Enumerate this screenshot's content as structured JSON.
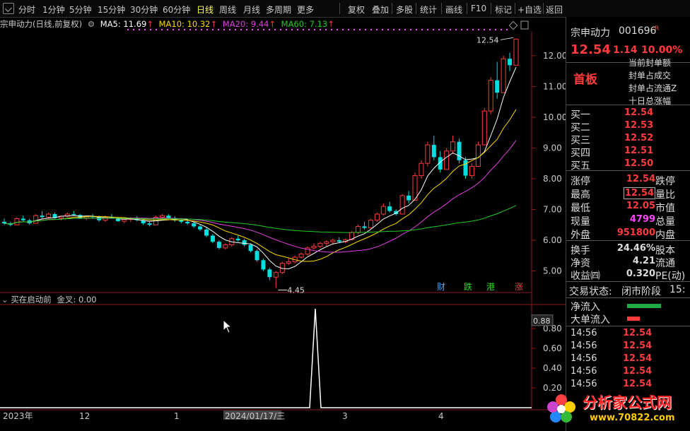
{
  "toolbar": {
    "left_items": [
      {
        "label": "分时",
        "active": false
      },
      {
        "label": "1分钟",
        "active": false
      },
      {
        "label": "5分钟",
        "active": false
      },
      {
        "label": "15分钟",
        "active": false
      },
      {
        "label": "30分钟",
        "active": false
      },
      {
        "label": "60分钟",
        "active": false
      },
      {
        "label": "日线",
        "active": true
      },
      {
        "label": "周线",
        "active": false
      },
      {
        "label": "月线",
        "active": false
      },
      {
        "label": "多周期",
        "active": false
      },
      {
        "label": "更多",
        "active": false
      }
    ],
    "right_items": [
      "复权",
      "叠加",
      "多股",
      "统计",
      "画线",
      "F10",
      "标记",
      "+自选",
      "返回"
    ]
  },
  "chart_header": {
    "stock_label": "宗申动力(日线,前复权)",
    "ma5": "MA5: 11.69",
    "ma10": "MA10: 10.32",
    "ma20": "MA20: 9.44",
    "ma60": "MA60: 7.13",
    "arrow": "↑"
  },
  "colors": {
    "up": "#ff3b3b",
    "down": "#00e0e0",
    "ma5": "#ffffff",
    "ma10": "#ffd700",
    "ma20": "#e040e0",
    "ma60": "#22cc22",
    "grid": "#8b1a1a"
  },
  "price_chart": {
    "y_ticks": [
      "12.00",
      "11.00",
      "10.00",
      "9.00",
      "8.00",
      "7.00",
      "6.00",
      "5.00"
    ],
    "high_label": "12.54",
    "low_label": "4.45",
    "markers": [
      {
        "text": "财",
        "color": "#44aaff"
      },
      {
        "text": "跌",
        "color": "#22dd22"
      },
      {
        "text": "港",
        "color": "#22dd22"
      },
      {
        "text": "涨",
        "color": "#ff3b3b"
      }
    ]
  },
  "chart_data": {
    "type": "candlestick",
    "ylim": [
      4.3,
      12.8
    ],
    "candles": [
      [
        6.6,
        6.7,
        6.5,
        6.55
      ],
      [
        6.55,
        6.6,
        6.45,
        6.5
      ],
      [
        6.5,
        6.75,
        6.5,
        6.7
      ],
      [
        6.7,
        6.8,
        6.6,
        6.65
      ],
      [
        6.65,
        6.7,
        6.5,
        6.55
      ],
      [
        6.55,
        6.85,
        6.55,
        6.8
      ],
      [
        6.8,
        6.95,
        6.7,
        6.75
      ],
      [
        6.75,
        6.9,
        6.7,
        6.85
      ],
      [
        6.85,
        6.9,
        6.7,
        6.72
      ],
      [
        6.72,
        6.8,
        6.65,
        6.78
      ],
      [
        6.78,
        6.9,
        6.75,
        6.85
      ],
      [
        6.85,
        6.95,
        6.8,
        6.82
      ],
      [
        6.82,
        6.85,
        6.7,
        6.72
      ],
      [
        6.72,
        6.8,
        6.65,
        6.78
      ],
      [
        6.78,
        6.85,
        6.7,
        6.75
      ],
      [
        6.75,
        6.8,
        6.6,
        6.65
      ],
      [
        6.65,
        6.8,
        6.6,
        6.75
      ],
      [
        6.75,
        6.85,
        6.7,
        6.72
      ],
      [
        6.72,
        6.75,
        6.6,
        6.62
      ],
      [
        6.62,
        6.7,
        6.55,
        6.68
      ],
      [
        6.68,
        6.75,
        6.6,
        6.7
      ],
      [
        6.7,
        6.78,
        6.62,
        6.65
      ],
      [
        6.65,
        6.7,
        6.5,
        6.55
      ],
      [
        6.55,
        6.6,
        6.45,
        6.5
      ],
      [
        6.5,
        6.8,
        6.5,
        6.75
      ],
      [
        6.75,
        6.85,
        6.7,
        6.8
      ],
      [
        6.8,
        6.85,
        6.7,
        6.72
      ],
      [
        6.72,
        6.78,
        6.6,
        6.65
      ],
      [
        6.65,
        6.7,
        6.55,
        6.6
      ],
      [
        6.6,
        6.65,
        6.5,
        6.55
      ],
      [
        6.55,
        6.6,
        6.4,
        6.45
      ],
      [
        6.45,
        6.5,
        6.3,
        6.35
      ],
      [
        6.35,
        6.4,
        6.1,
        6.15
      ],
      [
        6.15,
        6.2,
        5.9,
        5.95
      ],
      [
        5.95,
        6.0,
        5.7,
        5.75
      ],
      [
        5.75,
        5.9,
        5.7,
        5.85
      ],
      [
        5.85,
        6.1,
        5.8,
        6.05
      ],
      [
        6.05,
        6.15,
        5.95,
        6.0
      ],
      [
        6.0,
        6.05,
        5.8,
        5.85
      ],
      [
        5.85,
        5.9,
        5.6,
        5.65
      ],
      [
        5.65,
        5.7,
        5.3,
        5.35
      ],
      [
        5.35,
        5.4,
        5.0,
        5.05
      ],
      [
        5.05,
        5.1,
        4.7,
        4.8
      ],
      [
        4.8,
        5.0,
        4.45,
        4.95
      ],
      [
        4.95,
        5.3,
        4.9,
        5.25
      ],
      [
        5.25,
        5.4,
        5.2,
        5.3
      ],
      [
        5.3,
        5.5,
        5.25,
        5.45
      ],
      [
        5.45,
        5.6,
        5.4,
        5.55
      ],
      [
        5.55,
        5.8,
        5.5,
        5.75
      ],
      [
        5.75,
        5.9,
        5.7,
        5.8
      ],
      [
        5.8,
        5.95,
        5.75,
        5.9
      ],
      [
        5.9,
        6.0,
        5.8,
        5.95
      ],
      [
        5.95,
        6.05,
        5.85,
        6.0
      ],
      [
        6.0,
        6.1,
        5.9,
        5.95
      ],
      [
        5.95,
        6.05,
        5.9,
        6.02
      ],
      [
        6.02,
        6.3,
        6.0,
        6.25
      ],
      [
        6.25,
        6.5,
        6.2,
        6.45
      ],
      [
        6.45,
        6.6,
        6.35,
        6.4
      ],
      [
        6.4,
        6.7,
        6.4,
        6.65
      ],
      [
        6.65,
        6.9,
        6.6,
        6.85
      ],
      [
        6.85,
        7.2,
        6.8,
        7.1
      ],
      [
        7.1,
        7.25,
        6.9,
        6.95
      ],
      [
        6.95,
        7.0,
        6.8,
        6.85
      ],
      [
        6.85,
        7.5,
        6.85,
        7.45
      ],
      [
        7.45,
        7.6,
        7.2,
        7.3
      ],
      [
        7.3,
        8.2,
        7.3,
        8.1
      ],
      [
        8.1,
        8.6,
        8.0,
        8.5
      ],
      [
        8.5,
        9.2,
        8.4,
        9.1
      ],
      [
        9.1,
        9.4,
        8.6,
        8.7
      ],
      [
        8.7,
        8.9,
        8.2,
        8.3
      ],
      [
        8.3,
        9.0,
        8.3,
        8.9
      ],
      [
        8.9,
        9.4,
        8.8,
        9.2
      ],
      [
        9.2,
        9.3,
        8.5,
        8.6
      ],
      [
        8.6,
        8.7,
        8.0,
        8.1
      ],
      [
        8.1,
        8.5,
        8.0,
        8.4
      ],
      [
        8.4,
        9.2,
        8.4,
        9.1
      ],
      [
        9.1,
        10.3,
        9.1,
        10.2
      ],
      [
        10.2,
        11.3,
        10.1,
        11.2
      ],
      [
        11.2,
        11.8,
        10.6,
        10.8
      ],
      [
        10.8,
        12.0,
        10.8,
        11.9
      ],
      [
        11.9,
        12.1,
        11.5,
        11.69
      ],
      [
        11.69,
        12.54,
        11.69,
        12.54
      ]
    ]
  },
  "indicator": {
    "title": "买在启动前",
    "golden_cross": "金叉: 0.00",
    "y_ticks": [
      "0.80",
      "0.60",
      "0.40",
      "0.20"
    ],
    "current_value": "0.88"
  },
  "x_axis": {
    "labels": [
      {
        "text": "2023年"
      },
      {
        "text": "12"
      },
      {
        "text": "1"
      },
      {
        "text": "2024/01/17/三",
        "highlight": true
      },
      {
        "text": "3"
      },
      {
        "text": "4"
      }
    ]
  },
  "quote_panel": {
    "name": "宗申动力",
    "code": "001696",
    "tag": "R",
    "price": "12.54",
    "change": "1.14",
    "change_pct": "10.00%",
    "board_label": "首板",
    "limit_info": [
      "当前封单额",
      "封单占成交",
      "封单占流通Z",
      "十日总涨幅"
    ],
    "bids": [
      {
        "label": "买一",
        "price": "12.54"
      },
      {
        "label": "买二",
        "price": "12.53"
      },
      {
        "label": "买三",
        "price": "12.52"
      },
      {
        "label": "买四",
        "price": "12.51"
      },
      {
        "label": "买五",
        "price": "12.50"
      }
    ],
    "stats": [
      {
        "label": "涨停",
        "value": "12.54",
        "label2": "跌停",
        "color": "#ff3b3b"
      },
      {
        "label": "最高",
        "value": "12.54",
        "label2": "量比",
        "color": "#ff3b3b",
        "boxed": true
      },
      {
        "label": "最低",
        "value": "12.05",
        "label2": "市值",
        "color": "#ff3b3b"
      },
      {
        "label": "现量",
        "value": "4799",
        "label2": "总量",
        "color": "#ff44ff"
      },
      {
        "label": "外盘",
        "value": "951800",
        "label2": "内盘",
        "color": "#ff3b3b"
      }
    ],
    "stats2": [
      {
        "label": "换手",
        "value": "24.46%",
        "label2": "股本"
      },
      {
        "label": "净资",
        "value": "4.21",
        "label2": "流通"
      },
      {
        "label": "收益㈣",
        "value": "0.320",
        "label2": "PE(动)"
      }
    ],
    "trade_status_label": "交易状态:",
    "trade_status": "闭市阶段",
    "trade_time": "15:",
    "flows": [
      {
        "label": "净流入",
        "color": "#22aa44"
      },
      {
        "label": "大单流入",
        "color": "#ff3b3b"
      }
    ],
    "ticks": [
      {
        "time": "14:56",
        "price": "12.54"
      },
      {
        "time": "14:56",
        "price": "12.54"
      },
      {
        "time": "14:56",
        "price": "12.54"
      },
      {
        "time": "14:56",
        "price": "12.54"
      },
      {
        "time": "14:56",
        "price": "12.54"
      }
    ]
  },
  "watermark": {
    "text": "分析家公式网",
    "url": "www.70822.com"
  }
}
